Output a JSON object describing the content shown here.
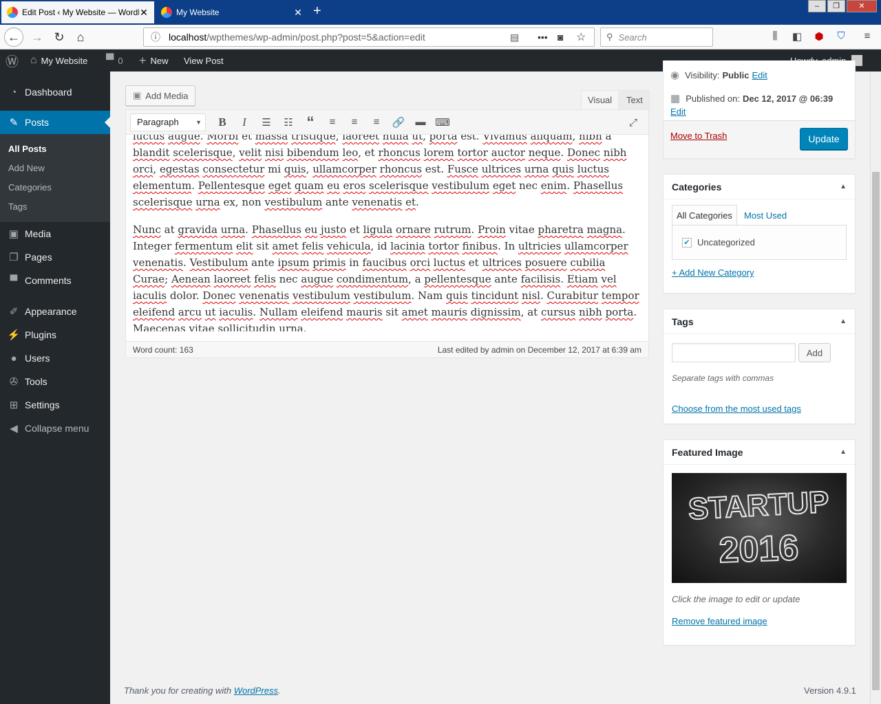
{
  "browser": {
    "tabs": [
      {
        "title": "Edit Post ‹ My Website — WordPress",
        "close": "✕"
      },
      {
        "title": "My Website",
        "close": "✕"
      }
    ],
    "new_tab": "+",
    "url_host": "localhost",
    "url_rest": "/wpthemes/wp-admin/post.php?post=5&action=edit",
    "search_placeholder": "Search"
  },
  "adminbar": {
    "site_name": "My Website",
    "comments_count": "0",
    "new_label": "New",
    "view_post": "View Post",
    "howdy": "Howdy, admin"
  },
  "sidebar": {
    "items": [
      {
        "label": "Dashboard",
        "icon": "dashboard-icon"
      },
      {
        "label": "Posts",
        "icon": "pin-icon"
      },
      {
        "label": "Media",
        "icon": "media-icon"
      },
      {
        "label": "Pages",
        "icon": "pages-icon"
      },
      {
        "label": "Comments",
        "icon": "comments-icon"
      },
      {
        "label": "Appearance",
        "icon": "appearance-icon"
      },
      {
        "label": "Plugins",
        "icon": "plugins-icon"
      },
      {
        "label": "Users",
        "icon": "users-icon"
      },
      {
        "label": "Tools",
        "icon": "tools-icon"
      },
      {
        "label": "Settings",
        "icon": "settings-icon"
      },
      {
        "label": "Collapse menu",
        "icon": "collapse-icon"
      }
    ],
    "submenu": [
      "All Posts",
      "Add New",
      "Categories",
      "Tags"
    ]
  },
  "editor": {
    "add_media": "Add Media",
    "tab_visual": "Visual",
    "tab_text": "Text",
    "format": "Paragraph",
    "word_count": "Word count: 163",
    "last_edited": "Last edited by admin on December 12, 2017 at 6:39 am"
  },
  "publish": {
    "visibility_label": "Visibility:",
    "visibility_value": "Public",
    "edit": "Edit",
    "published_label": "Published on:",
    "published_value": "Dec 12, 2017 @ 06:39",
    "trash": "Move to Trash",
    "update": "Update"
  },
  "categories": {
    "title": "Categories",
    "tab_all": "All Categories",
    "tab_used": "Most Used",
    "item": "Uncategorized",
    "add_new": "+ Add New Category"
  },
  "tags": {
    "title": "Tags",
    "add": "Add",
    "hint": "Separate tags with commas",
    "choose": "Choose from the most used tags"
  },
  "featured": {
    "title": "Featured Image",
    "image_text_1": "STARTUP",
    "image_text_2": "2016",
    "hint": "Click the image to edit or update",
    "remove": "Remove featured image"
  },
  "footer": {
    "thanks_prefix": "Thank you for creating with ",
    "thanks_link": "WordPress",
    "thanks_suffix": ".",
    "version": "Version 4.9.1"
  }
}
